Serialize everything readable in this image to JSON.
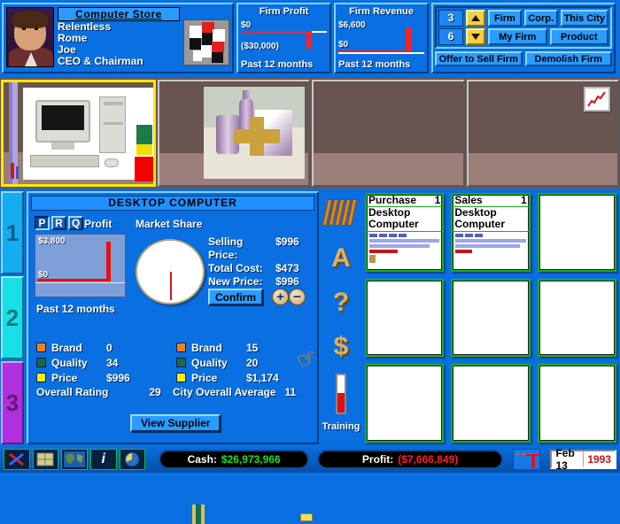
{
  "firm": {
    "store_name": "Computer Store",
    "lines": [
      "Relentless",
      "Rome",
      "Joe",
      "CEO & Chairman"
    ],
    "portrait_icon": "executive-portrait",
    "logo_icon": "company-cube-logo"
  },
  "stats": [
    {
      "title": "Firm Profit",
      "top_label": "$0",
      "bottom_label": "($30,000)",
      "footer": "Past 12 months"
    },
    {
      "title": "Firm Revenue",
      "top_label": "$6,600",
      "bottom_label": "$0",
      "footer": "Past 12 months"
    }
  ],
  "controls": {
    "num_top": "3",
    "num_bottom": "6",
    "up_icon": "arrow-up-icon",
    "down_icon": "arrow-down-icon",
    "row1": [
      "Firm",
      "Corp.",
      "This City"
    ],
    "row2": [
      "My Firm",
      "Product"
    ],
    "sell_label": "Offer to Sell Firm",
    "demolish_label": "Demolish Firm"
  },
  "store": {
    "bays": [
      {
        "product": "desktop-computer",
        "selected": true
      },
      {
        "product": "ceramics",
        "selected": false
      },
      {
        "product": "",
        "selected": false
      },
      {
        "product": "",
        "selected": false
      }
    ],
    "chart_icon": "trend-chart-icon"
  },
  "floors": [
    {
      "label": "1",
      "color": "#14aef0"
    },
    {
      "label": "2",
      "color": "#18e0e8"
    },
    {
      "label": "3",
      "color": "#b030e0"
    }
  ],
  "product_panel": {
    "title": "DESKTOP COMPUTER",
    "prq": [
      {
        "label": "P",
        "selected": true
      },
      {
        "label": "R",
        "selected": false
      },
      {
        "label": "Q",
        "selected": false
      }
    ],
    "profit_label": "Profit",
    "market_share_label": "Market Share",
    "profit_chart_top": "$3,800",
    "profit_chart_bottom": "$0",
    "profit_footer": "Past 12 months",
    "info": [
      {
        "label": "Selling Price:",
        "value": "$996"
      },
      {
        "label": "Total Cost:",
        "value": "$473"
      },
      {
        "label": "New Price:",
        "value": "$996"
      }
    ],
    "confirm_label": "Confirm",
    "plus_icon": "plus-icon",
    "minus_icon": "minus-icon",
    "left_stats": [
      {
        "swatch": "orange",
        "name": "Brand",
        "value": "0"
      },
      {
        "swatch": "green",
        "name": "Quality",
        "value": "34"
      },
      {
        "swatch": "yellow",
        "name": "Price",
        "value": "$996"
      }
    ],
    "right_stats": [
      {
        "swatch": "orange",
        "name": "Brand",
        "value": "15"
      },
      {
        "swatch": "green",
        "name": "Quality",
        "value": "20"
      },
      {
        "swatch": "yellow",
        "name": "Price",
        "value": "$1,174"
      }
    ],
    "overall_rating_label": "Overall Rating",
    "overall_rating_value": "29",
    "city_average_label": "City Overall Average",
    "city_average_value": "11",
    "view_supplier_label": "View Supplier",
    "hand_icon": "pointing-hand-icon"
  },
  "toolbar": [
    {
      "icon": "books-inventory-icon",
      "label": ""
    },
    {
      "icon": "advertising-a-icon",
      "label": ""
    },
    {
      "icon": "help-question-icon",
      "label": ""
    },
    {
      "icon": "finance-dollar-icon",
      "label": ""
    },
    {
      "icon": "training-thermometer-icon",
      "label": "Training"
    }
  ],
  "cards": [
    {
      "header": "Purchase",
      "count": "1",
      "name1": "Desktop",
      "name2": "Computer",
      "filled": true
    },
    {
      "header": "Sales",
      "count": "1",
      "name1": "Desktop",
      "name2": "Computer",
      "filled": true
    },
    {
      "header": "",
      "count": "",
      "name1": "",
      "name2": "",
      "filled": false
    },
    {
      "header": "",
      "count": "",
      "name1": "",
      "name2": "",
      "filled": false
    },
    {
      "header": "",
      "count": "",
      "name1": "",
      "name2": "",
      "filled": false
    },
    {
      "header": "",
      "count": "",
      "name1": "",
      "name2": "",
      "filled": false
    },
    {
      "header": "",
      "count": "",
      "name1": "",
      "name2": "",
      "filled": false
    },
    {
      "header": "",
      "count": "",
      "name1": "",
      "name2": "",
      "filled": false
    },
    {
      "header": "",
      "count": "",
      "name1": "",
      "name2": "",
      "filled": false
    }
  ],
  "statusbar": {
    "icons": [
      "tools-icon",
      "city-grid-icon",
      "world-map-icon",
      "info-icon",
      "clock-icon"
    ],
    "info_glyph": "i",
    "cash_label": "Cash:",
    "cash_value": "$26,973,966",
    "profit_label": "Profit:",
    "profit_value": "($7,666,849)",
    "graph_icon": "mini-graph-icon",
    "date": "Feb 13",
    "year": "1993"
  },
  "colors": {
    "panel_blue": "#0a6fe0",
    "accent_blue": "#2a9cff",
    "cash_green": "#20e020",
    "loss_red": "#ff2020",
    "highlight_yellow": "#ffe800"
  }
}
